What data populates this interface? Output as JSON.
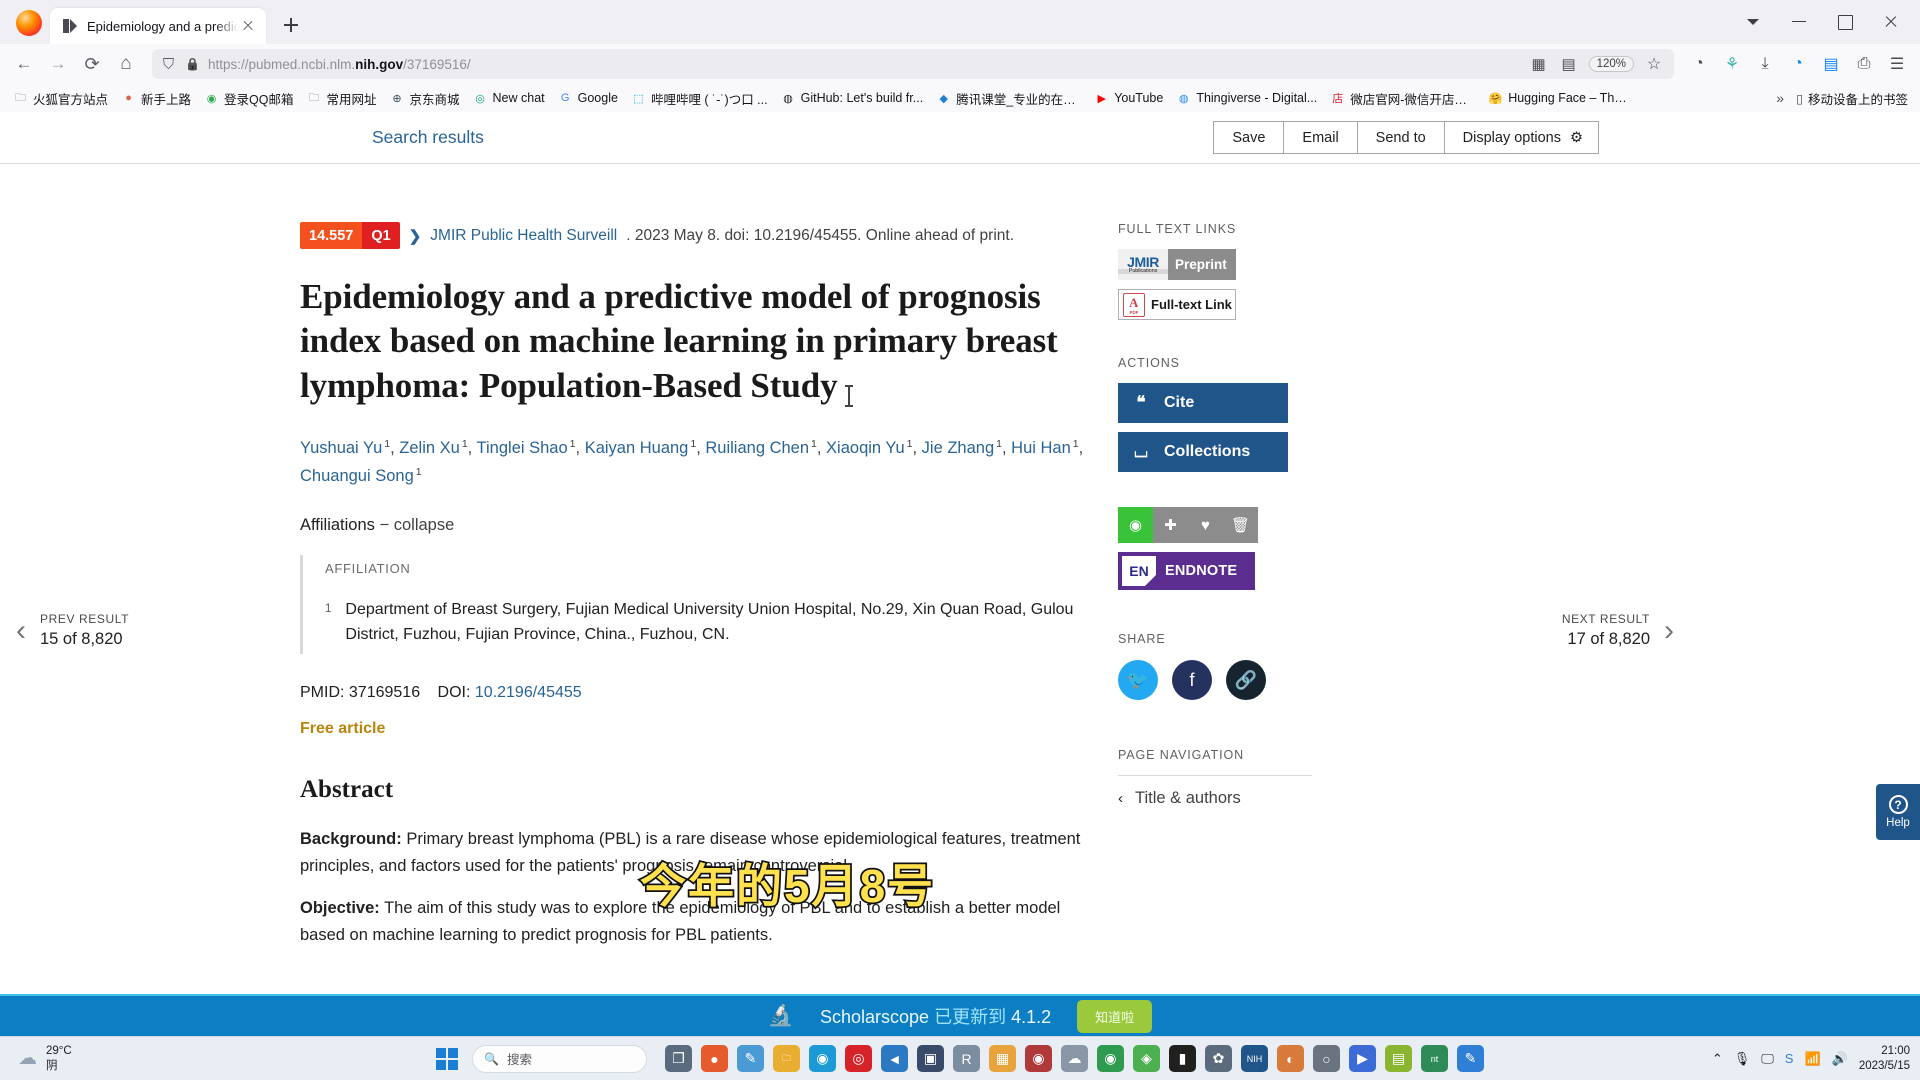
{
  "browser": {
    "tab": {
      "title": "Epidemiology and a predictiv",
      "close_label": "×"
    },
    "newtab_label": "+",
    "window_controls": {
      "list_all": "⌄",
      "minimize": "—",
      "maximize": "▢",
      "close": "✕"
    },
    "nav": {
      "back": "←",
      "forward": "→",
      "reload": "⟳",
      "home": "⌂"
    },
    "url": {
      "prefix": "https://pubmed.ncbi.nlm.",
      "domain": "nih.gov",
      "path": "/37169516/"
    },
    "zoom_level": "120%",
    "bookmarks": [
      {
        "label": "火狐官方站点",
        "icon": "folder-icon",
        "color": "#6b7380",
        "glyph": "🗀"
      },
      {
        "label": "新手上路",
        "icon": "firefox-icon",
        "color": "#e0604a",
        "glyph": "●"
      },
      {
        "label": "登录QQ邮箱",
        "icon": "qqmail-icon",
        "color": "#2fa84f",
        "glyph": "◉"
      },
      {
        "label": "常用网址",
        "icon": "folder-icon",
        "color": "#6b7380",
        "glyph": "🗀"
      },
      {
        "label": "京东商城",
        "icon": "globe-icon",
        "color": "#3f4a57",
        "glyph": "⊕"
      },
      {
        "label": "New chat",
        "icon": "openai-icon",
        "color": "#10a37f",
        "glyph": "◎"
      },
      {
        "label": "Google",
        "icon": "google-icon",
        "color": "#4285f4",
        "glyph": "G"
      },
      {
        "label": "哔哩哔哩 ( ˙-˙)つ口 ...",
        "icon": "bilibili-icon",
        "color": "#00a1d6",
        "glyph": "⬚"
      },
      {
        "label": "GitHub: Let's build fr...",
        "icon": "github-icon",
        "color": "#1b1f23",
        "glyph": "◍"
      },
      {
        "label": "腾讯课堂_专业的在线...",
        "icon": "tencent-icon",
        "color": "#1f7fd8",
        "glyph": "◆"
      },
      {
        "label": "YouTube",
        "icon": "youtube-icon",
        "color": "#ff0000",
        "glyph": "▶"
      },
      {
        "label": "Thingiverse - Digital...",
        "icon": "thingiverse-icon",
        "color": "#248bfb",
        "glyph": "◍"
      },
      {
        "label": "微店官网-微信开店用...",
        "icon": "weidian-icon",
        "color": "#d6202a",
        "glyph": "店"
      },
      {
        "label": "Hugging Face – The ...",
        "icon": "huggingface-icon",
        "color": "#ffd21e",
        "glyph": "🤗"
      }
    ],
    "bookmarks_overflow": "»",
    "mobile_bookmarks": "移动设备上的书签"
  },
  "pubmed": {
    "search_results_link": "Search results",
    "actions": {
      "save": "Save",
      "email": "Email",
      "send_to": "Send to",
      "display_options": "Display options"
    },
    "prev_result": {
      "label": "PREV RESULT",
      "count": "15 of 8,820",
      "arrow": "‹"
    },
    "next_result": {
      "label": "NEXT RESULT",
      "count": "17 of 8,820",
      "arrow": "›"
    },
    "citation": {
      "impact_factor": "14.557",
      "quartile": "Q1",
      "chevron": "❯",
      "journal": "JMIR Public Health Surveill",
      "rest": ". 2023 May 8. doi: 10.2196/45455. Online ahead of print."
    },
    "title": "Epidemiology and a predictive model of prognosis index based on machine learning in primary breast lymphoma: Population-Based Study",
    "authors": [
      {
        "name": "Yushuai Yu",
        "sup": "1"
      },
      {
        "name": "Zelin Xu",
        "sup": "1"
      },
      {
        "name": "Tinglei Shao",
        "sup": "1"
      },
      {
        "name": "Kaiyan Huang",
        "sup": "1"
      },
      {
        "name": "Ruiliang Chen",
        "sup": "1"
      },
      {
        "name": "Xiaoqin Yu",
        "sup": "1"
      },
      {
        "name": "Jie Zhang",
        "sup": "1"
      },
      {
        "name": "Hui Han",
        "sup": "1"
      },
      {
        "name": "Chuangui Song",
        "sup": "1"
      }
    ],
    "affiliations_toggle": {
      "label": "Affiliations",
      "dash": "−",
      "action": "collapse"
    },
    "affiliation_header": "AFFILIATION",
    "affiliation_items": [
      {
        "num": "1",
        "text": "Department of Breast Surgery, Fujian Medical University Union Hospital, No.29, Xin Quan Road, Gulou District, Fuzhou, Fujian Province, China., Fuzhou, CN."
      }
    ],
    "pmid_label": "PMID:",
    "pmid_value": "37169516",
    "doi_label": "DOI:",
    "doi_value": "10.2196/45455",
    "free_article": "Free article",
    "abstract_heading": "Abstract",
    "abstract_paragraphs": [
      {
        "label": "Background:",
        "text": " Primary breast lymphoma (PBL) is a rare disease whose epidemiological features, treatment principles, and factors used for the patients' prognosis remain controversial."
      },
      {
        "label": "Objective:",
        "text": " The aim of this study was to explore the epidemiology of PBL and to establish a better model based on machine learning to predict prognosis for PBL patients."
      }
    ],
    "sidebar": {
      "full_text_links_head": "FULL TEXT LINKS",
      "jmir": {
        "logo_top": "JMIR",
        "logo_bottom": "Publications",
        "label": "Preprint"
      },
      "fulltext": {
        "icon_letter": "A",
        "icon_sub": "PDF",
        "label": "Full-text Link"
      },
      "actions_head": "ACTIONS",
      "cite": {
        "icon": "quote-icon",
        "glyph": "❝",
        "label": "Cite"
      },
      "collections": {
        "icon": "bookmark-icon",
        "glyph": "🔖",
        "label": "Collections"
      },
      "tools": [
        {
          "name": "eye-icon",
          "glyph": "👁",
          "active": true
        },
        {
          "name": "pin-icon",
          "glyph": "📌",
          "active": false
        },
        {
          "name": "heart-icon",
          "glyph": "♥",
          "active": false
        },
        {
          "name": "trash-icon",
          "glyph": "🗑",
          "active": false
        }
      ],
      "endnote": {
        "badge": "EN",
        "label": "ENDNOTE"
      },
      "share_head": "SHARE",
      "share_icons": [
        {
          "name": "twitter-icon",
          "glyph": "🐦",
          "color": "#23a9f2"
        },
        {
          "name": "facebook-icon",
          "glyph": "f",
          "color": "#24325f"
        },
        {
          "name": "link-icon",
          "glyph": "🔗",
          "color": "#16242f"
        }
      ],
      "page_navigation_head": "PAGE NAVIGATION",
      "page_nav_items": [
        {
          "chevron": "‹",
          "label": "Title & authors"
        }
      ]
    },
    "help_tab": {
      "icon_glyph": "?",
      "label": "Help"
    },
    "subtitle_overlay": "今年的5月8号"
  },
  "banner": {
    "icon": "microscope-icon",
    "glyph": "🔬",
    "text_prefix": "Scholarscope ",
    "text_highlight": "已更新到",
    "text_suffix": " 4.1.2",
    "button": "知道啦"
  },
  "taskbar": {
    "weather": {
      "temp": "29°C",
      "desc": "阴"
    },
    "search_placeholder": "搜索",
    "search_icon": "search-icon",
    "apps": [
      {
        "name": "task-view-icon",
        "glyph": "❐",
        "color": "#5a6b7d"
      },
      {
        "name": "firefox-icon",
        "glyph": "●",
        "color": "#e55b2b"
      },
      {
        "name": "editor-icon",
        "glyph": "✎",
        "color": "#4a9ad6"
      },
      {
        "name": "explorer-icon",
        "glyph": "🗀",
        "color": "#e8ae32"
      },
      {
        "name": "edge-icon",
        "glyph": "◉",
        "color": "#1c9ad6"
      },
      {
        "name": "opera-icon",
        "glyph": "◎",
        "color": "#d6232a"
      },
      {
        "name": "vscode-icon",
        "glyph": "◄",
        "color": "#2b79c2"
      },
      {
        "name": "obs-icon",
        "glyph": "▣",
        "color": "#3a4a6b"
      },
      {
        "name": "r-studio-icon",
        "glyph": "R",
        "color": "#7a8ea0"
      },
      {
        "name": "calculator-icon",
        "glyph": "▦",
        "color": "#e8a33d"
      },
      {
        "name": "zotero-icon",
        "glyph": "◉",
        "color": "#b03a3a"
      },
      {
        "name": "cloud-icon",
        "glyph": "☁",
        "color": "#8a97a6"
      },
      {
        "name": "chrome-icon",
        "glyph": "◉",
        "color": "#2e9b50"
      },
      {
        "name": "maps-icon",
        "glyph": "◈",
        "color": "#4caf50"
      },
      {
        "name": "terminal-icon",
        "glyph": "▮",
        "color": "#20201f"
      },
      {
        "name": "settings-icon",
        "glyph": "✿",
        "color": "#5b6b7d"
      },
      {
        "name": "nih-icon",
        "glyph": "NIH",
        "color": "#20558a"
      },
      {
        "name": "media-icon",
        "glyph": "◐",
        "color": "#d87b3a"
      },
      {
        "name": "circle-icon",
        "glyph": "○",
        "color": "#6b7380"
      },
      {
        "name": "video-icon",
        "glyph": "▶",
        "color": "#3a6bd6"
      },
      {
        "name": "grid-icon",
        "glyph": "▤",
        "color": "#8ab52e"
      },
      {
        "name": "nt-icon",
        "glyph": "nt",
        "color": "#2e8b57"
      },
      {
        "name": "notes-icon",
        "glyph": "✎",
        "color": "#2f7fd6"
      }
    ],
    "tray": [
      {
        "name": "chevron-up-icon",
        "glyph": "⌃"
      },
      {
        "name": "microphone-icon",
        "glyph": "🎙"
      },
      {
        "name": "monitor-icon",
        "glyph": "🖵"
      },
      {
        "name": "sogou-icon",
        "glyph": "S"
      },
      {
        "name": "wifi-icon",
        "glyph": "📶"
      },
      {
        "name": "volume-icon",
        "glyph": "🔊"
      }
    ],
    "clock": {
      "time": "21:00",
      "date": "2023/5/15"
    }
  }
}
